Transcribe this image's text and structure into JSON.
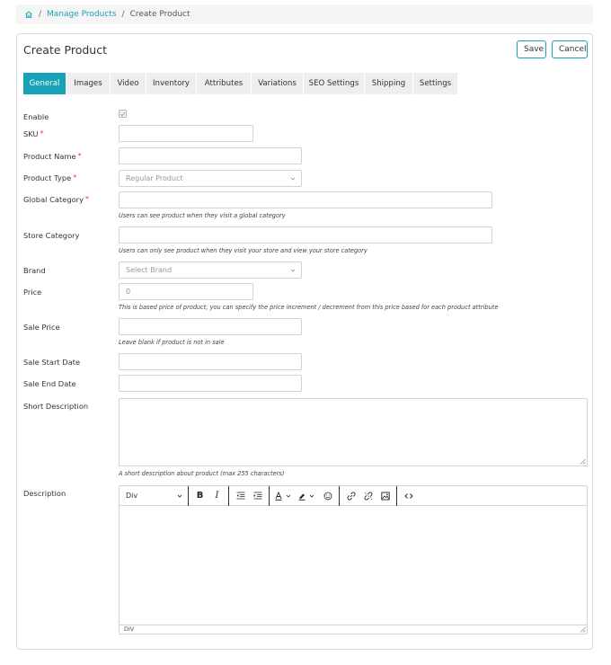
{
  "breadcrumb": {
    "items": [
      "Manage Products",
      "Create Product"
    ],
    "separator": "/"
  },
  "header": {
    "title": "Create Product",
    "save_label": "Save",
    "cancel_label": "Cancel"
  },
  "tabs": [
    "General",
    "Images",
    "Video",
    "Inventory",
    "Attributes",
    "Variations",
    "SEO Settings",
    "Shipping",
    "Settings"
  ],
  "form": {
    "enable_label": "Enable",
    "sku_label": "SKU",
    "product_name_label": "Product Name",
    "product_type_label": "Product Type",
    "product_type_value": "Regular Product",
    "global_category_label": "Global Category",
    "global_category_help": "Users can see product when they visit a global category",
    "store_category_label": "Store Category",
    "store_category_help": "Users can only see product when they visit your store and view your store category",
    "brand_label": "Brand",
    "brand_placeholder": "Select Brand",
    "price_label": "Price",
    "price_value": "0",
    "price_help": "This is based price of product, you can specify the price increment / decrement from this price based for each product attribute",
    "sale_price_label": "Sale Price",
    "sale_price_help": "Leave blank if product is not in sale",
    "sale_start_label": "Sale Start Date",
    "sale_end_label": "Sale End Date",
    "short_desc_label": "Short Description",
    "short_desc_help": "A short description about product (max 255 characters)",
    "description_label": "Description",
    "required_mark": "*"
  },
  "editor": {
    "block_format": "Div",
    "status_path": "DIV",
    "icons": [
      "bold-icon",
      "italic-icon",
      "outdent-icon",
      "indent-icon",
      "text-color-icon",
      "highlight-color-icon",
      "emoticon-icon",
      "link-icon",
      "unlink-icon",
      "image-icon",
      "source-code-icon"
    ]
  },
  "colors": {
    "accent": "#17a2b8",
    "required": "#e03a3a",
    "tab_inactive": "#eeeeee"
  }
}
